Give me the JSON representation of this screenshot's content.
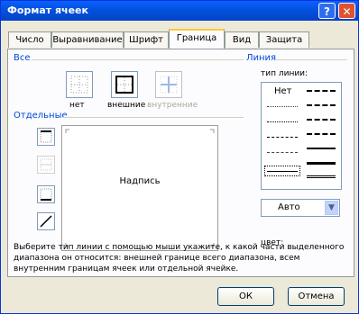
{
  "window": {
    "title": "Формат ячеек",
    "help_label": "?",
    "close_label": "✕"
  },
  "tabs": [
    {
      "label": "Число"
    },
    {
      "label": "Выравнивание"
    },
    {
      "label": "Шрифт"
    },
    {
      "label": "Граница",
      "active": true
    },
    {
      "label": "Вид"
    },
    {
      "label": "Защита"
    }
  ],
  "presets": {
    "group_label": "Все",
    "items": [
      {
        "label": "нет",
        "icon": "border-none-icon"
      },
      {
        "label": "внешние",
        "icon": "border-outline-icon"
      },
      {
        "label": "внутренние",
        "icon": "border-inside-icon",
        "disabled": true
      }
    ]
  },
  "borders": {
    "group_label": "Отдельные",
    "preview_text": "Надпись"
  },
  "line": {
    "group_label": "Линия",
    "style_label": "тип линии:",
    "none_label": "Нет",
    "color_label": "цвет:",
    "color_value": "Авто"
  },
  "help_text": "Выберите тип линии с помощью мыши укажите, к какой части выделенного диапазона он относится: внешней границе всего диапазона, всем внутренним границам ячеек или отдельной ячейке.",
  "buttons": {
    "ok": "ОК",
    "cancel": "Отмена"
  },
  "colors": {
    "title_bar": "#0453e0",
    "active_tab": "#ffc83c",
    "group_label": "#0046d5"
  }
}
